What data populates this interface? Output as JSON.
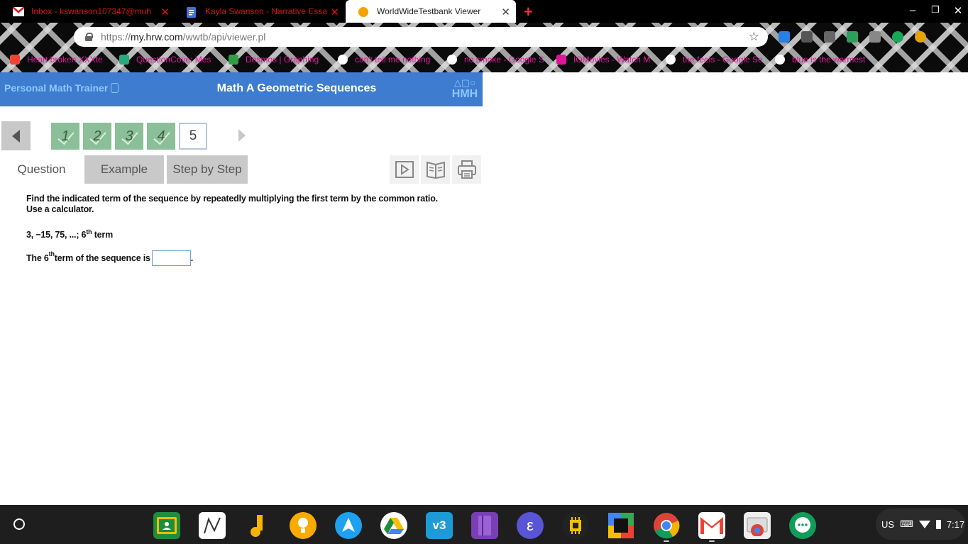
{
  "browser": {
    "tabs": [
      {
        "label": "Inbox - kswanson107347@muh",
        "icon": "gmail-icon",
        "color": "#d11"
      },
      {
        "label": "Kayla Swanson - Narrative Essa",
        "icon": "google-docs-icon",
        "color": "#3b74e0"
      },
      {
        "label": "WorldWideTestbank Viewer",
        "icon": "orange-circle-icon",
        "color": "#f4a300",
        "active": true
      }
    ],
    "url_scheme": "https://",
    "url_host": "my.hrw.com",
    "url_path": "/wwtb/api/viewer.pl",
    "bookmarks": [
      {
        "label": "Heart broken XXXte",
        "icon": "red-heart-icon",
        "color": "#e43"
      },
      {
        "label": "QuestionCove: Mes",
        "icon": "questioncove-icon",
        "color": "#2aa87f"
      },
      {
        "label": "Desmos | Graphing",
        "icon": "desmos-icon",
        "color": "#2f9e44"
      },
      {
        "label": "can't tell me nothing",
        "icon": "google-icon",
        "color": "#fff"
      },
      {
        "label": "no smoke - Google S",
        "icon": "google-icon",
        "color": "#fff"
      },
      {
        "label": "IOMovies - Watch M",
        "icon": "iomovies-icon",
        "color": "#e0169a"
      },
      {
        "label": "the feels - Google Se",
        "icon": "google-icon",
        "color": "#fff"
      },
      {
        "label": "blue is the warmest",
        "icon": "google-icon",
        "color": "#fff"
      }
    ]
  },
  "app": {
    "brand": "Personal Math Trainer",
    "title": "Math A Geometric Sequences",
    "logo_shapes": "△▢○",
    "logo_word": "HMH",
    "header_color": "#3d7ccf"
  },
  "question_nav": {
    "numbers": [
      "1",
      "2",
      "3",
      "4",
      "5"
    ],
    "completed": [
      true,
      true,
      true,
      true,
      false
    ],
    "current": "5"
  },
  "mode_tabs": {
    "question": "Question",
    "example": "Example",
    "step_by_step": "Step by Step"
  },
  "tools": [
    "play-video-icon",
    "open-book-icon",
    "print-icon"
  ],
  "question": {
    "instruction_line1": "Find the indicated term of the sequence by repeatedly multiplying the first term by the common ratio.",
    "instruction_line2": "Use a calculator.",
    "sequence": "3, −15, 75, ...; 6",
    "sequence_sup": "th",
    "sequence_suffix": " term",
    "answer_prefix": "The 6",
    "answer_sup": "th",
    "answer_middle": " term of the sequence is",
    "answer_value": "",
    "answer_suffix": "."
  },
  "shelf": {
    "apps": [
      {
        "name": "google-classroom-icon",
        "color": "#1e8e3e"
      },
      {
        "name": "desmos-app-icon",
        "color": "#ffffff"
      },
      {
        "name": "music-icon",
        "color": "#f7b500"
      },
      {
        "name": "keep-icon",
        "color": "#f9ab00"
      },
      {
        "name": "vectr-icon",
        "color": "#1da1f2"
      },
      {
        "name": "google-drive-icon",
        "color": "#ffffff"
      },
      {
        "name": "v3-icon",
        "color": "#1d9bd7"
      },
      {
        "name": "notebook-icon",
        "color": "#7a3fb5"
      },
      {
        "name": "epic-icon",
        "color": "#5a55d6"
      },
      {
        "name": "chip-icon",
        "color": "#f2c200"
      },
      {
        "name": "multicolor-square-icon",
        "color": "#34a853"
      },
      {
        "name": "chrome-icon",
        "color": "#db4437"
      },
      {
        "name": "gmail-app-icon",
        "color": "#ffffff"
      },
      {
        "name": "chrome-remote-icon",
        "color": "#eeeeee"
      },
      {
        "name": "hangouts-icon",
        "color": "#0f9d58"
      }
    ],
    "locale": "US",
    "clock": "7:17"
  }
}
